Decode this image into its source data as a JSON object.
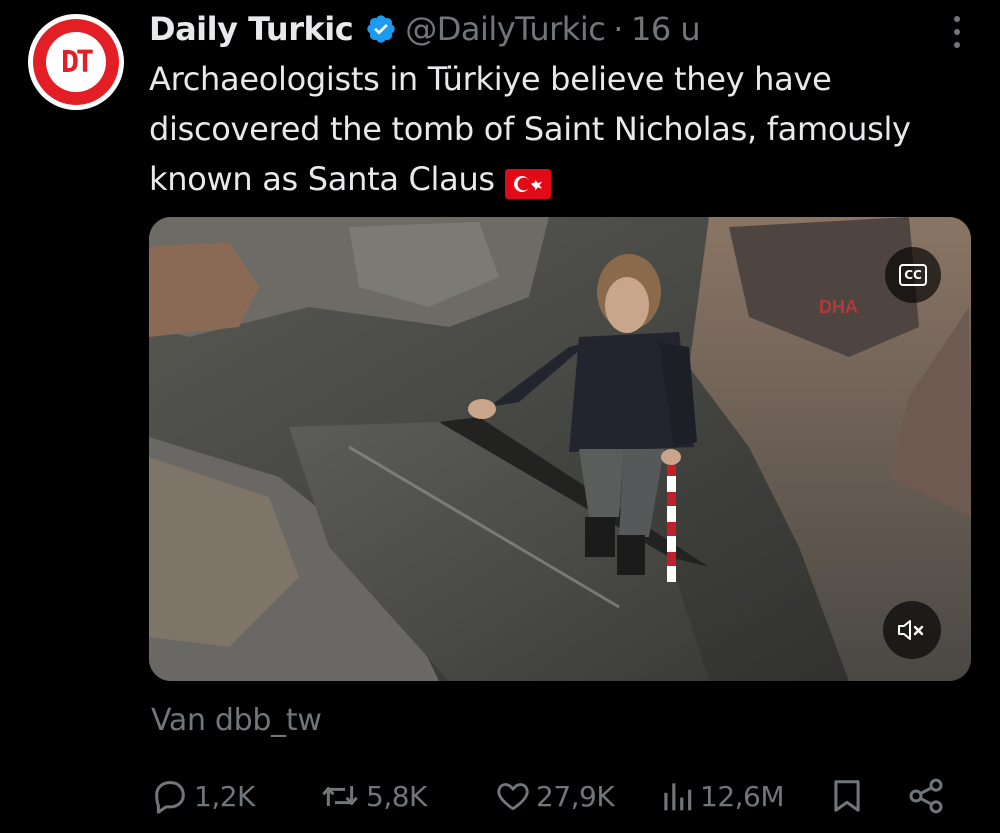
{
  "author": {
    "display_name": "Daily Turkic",
    "handle": "@DailyTurkic",
    "separator": "·",
    "time": "16 u",
    "avatar_text": "DT",
    "avatar_color": "#e31e24",
    "verified_color": "#1d9bf0"
  },
  "tweet": {
    "text": "Archaeologists in Türkiye believe they have discovered the tomb of Saint Nicholas, famously known as Santa Claus",
    "flag_icon": "turkey-flag-icon"
  },
  "media": {
    "type": "video",
    "cc_label": "CC",
    "mute_icon": "volume-muted-icon",
    "watermark": "DHA"
  },
  "attribution": "Van dbb_tw",
  "actions": {
    "replies": "1,2K",
    "reposts": "5,8K",
    "likes": "27,9K",
    "views": "12,6M"
  },
  "colors": {
    "background": "#000000",
    "text_primary": "#e7e9ea",
    "text_secondary": "#71767b"
  }
}
